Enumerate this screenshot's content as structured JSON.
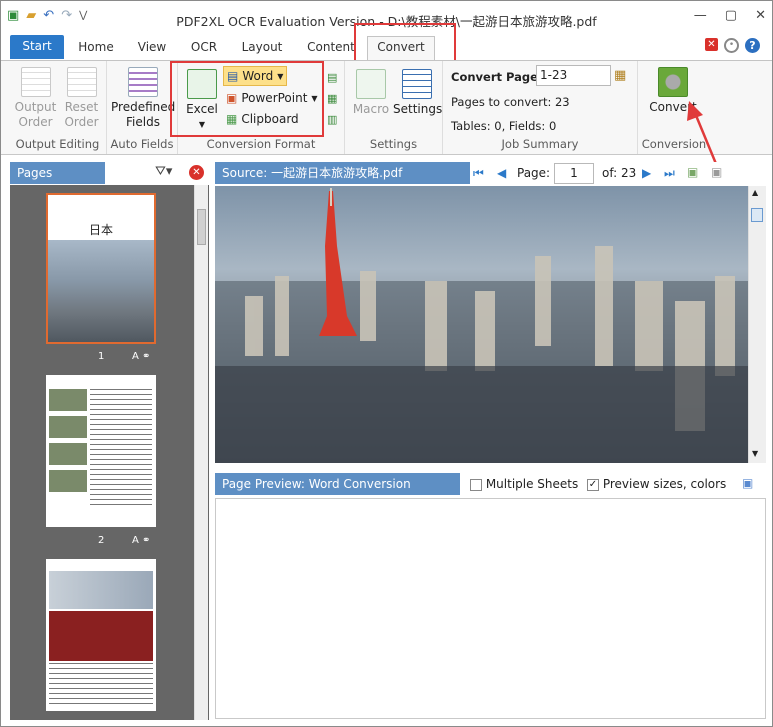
{
  "title": "PDF2XL OCR Evaluation Version - D:\\教程素材\\一起游日本旅游攻略.pdf",
  "tabs": [
    "Start",
    "Home",
    "View",
    "OCR",
    "Layout",
    "Content",
    "Convert"
  ],
  "ribbon": {
    "output_editing": {
      "label": "Output Editing",
      "output_order": "Output\nOrder",
      "reset_order": "Reset\nOrder"
    },
    "auto_fields": {
      "label": "Auto Fields",
      "predefined": "Predefined\nFields"
    },
    "conversion_format": {
      "label": "Conversion Format",
      "excel": "Excel",
      "word": "Word",
      "powerpoint": "PowerPoint",
      "clipboard": "Clipboard"
    },
    "settings": {
      "label": "Settings",
      "macro": "Macro",
      "settings": "Settings"
    },
    "job_summary": {
      "label": "Job Summary",
      "convert_pages_label": "Convert Pages:",
      "convert_pages_value": "1-23",
      "pages_to_convert": "Pages to convert: 23",
      "tables_fields": "Tables: 0, Fields: 0"
    },
    "conversion": {
      "label": "Conversion",
      "convert": "Convert"
    }
  },
  "pages_panel": {
    "title": "Pages",
    "thumbs": [
      {
        "num": "1",
        "title": "日本"
      },
      {
        "num": "2"
      }
    ]
  },
  "source": {
    "label": "Source: 一起游日本旅游攻略.pdf",
    "page_label": "Page:",
    "page_value": "1",
    "of_label": "of: 23"
  },
  "preview": {
    "label": "Page Preview: Word Conversion",
    "multiple_sheets": "Multiple Sheets",
    "preview_sizes": "Preview sizes, colors"
  },
  "colors": {
    "accent": "#2b79c9",
    "highlight": "#e03a3a",
    "panel_header": "#5e8fc4"
  }
}
